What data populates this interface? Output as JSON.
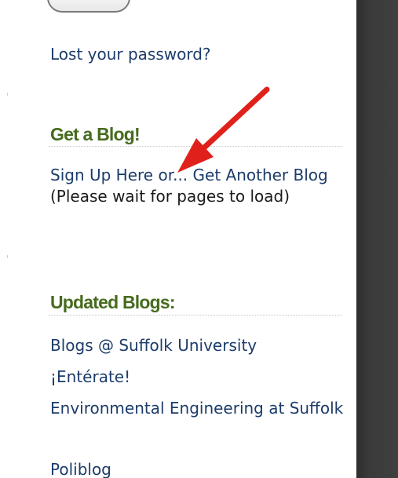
{
  "login": {
    "lost_password": "Lost your password?"
  },
  "get_blog": {
    "heading": "Get a Blog!",
    "signup_link": "Sign Up Here or... Get Another Blog",
    "signup_note": "(Please wait for pages to load)"
  },
  "updated_blogs": {
    "heading": "Updated Blogs:",
    "items": [
      "Blogs @ Suffolk University",
      "¡Entérate!",
      "Environmental Engineering at Suffolk",
      "Poliblog"
    ]
  },
  "colors": {
    "link": "#1c3c6a",
    "heading": "#466b1e",
    "arrow": "#e0211b",
    "dark_panel": "#3a3a3a"
  }
}
